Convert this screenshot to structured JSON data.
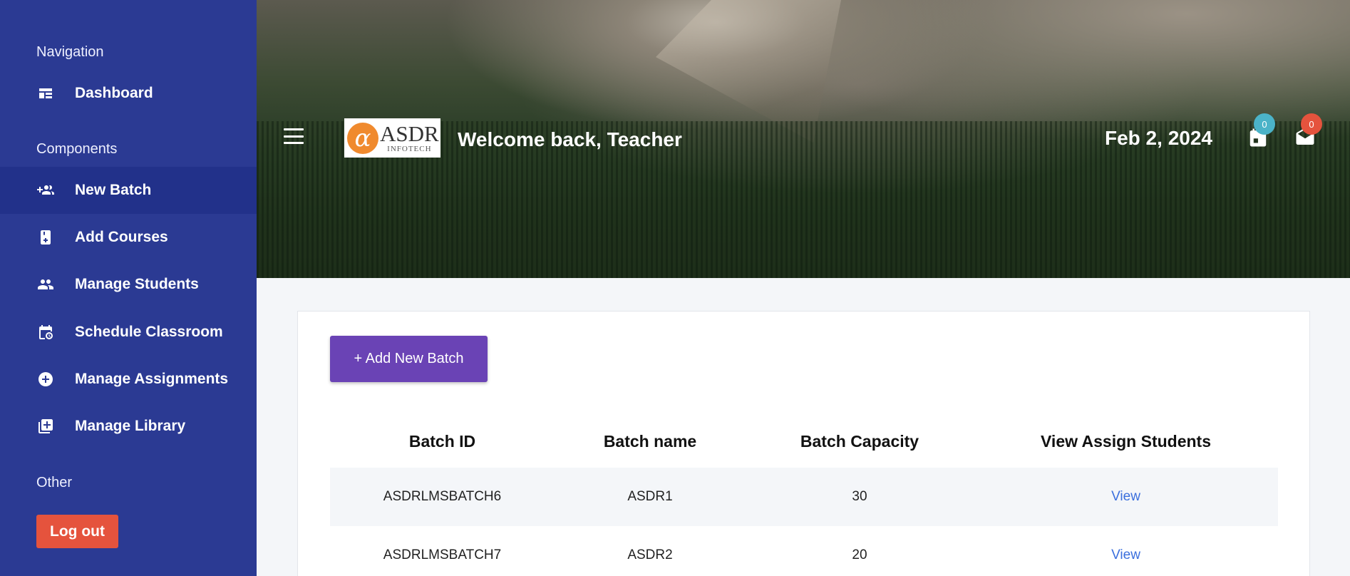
{
  "sidebar": {
    "sections": {
      "navigation": "Navigation",
      "components": "Components",
      "other": "Other"
    },
    "items": [
      {
        "label": "Dashboard",
        "icon": "dashboard-icon"
      },
      {
        "label": "New Batch",
        "icon": "group-add-icon",
        "active": true
      },
      {
        "label": "Add Courses",
        "icon": "book-add-icon"
      },
      {
        "label": "Manage Students",
        "icon": "people-icon"
      },
      {
        "label": "Schedule Classroom",
        "icon": "calendar-clock-icon"
      },
      {
        "label": "Manage Assignments",
        "icon": "plus-circle-icon"
      },
      {
        "label": "Manage Library",
        "icon": "library-add-icon"
      }
    ],
    "logout_label": "Log out"
  },
  "header": {
    "welcome": "Welcome back, Teacher",
    "logo_main": "ASDR",
    "logo_sub": "INFOTECH",
    "logo_symbol": "α",
    "date": "Feb 2, 2024",
    "calendar_badge": "0",
    "mail_badge": "0",
    "colors": {
      "calendar_badge": "#4bb3c8",
      "mail_badge": "#e5533d"
    }
  },
  "main": {
    "add_button_label": "+ Add New Batch",
    "table": {
      "headers": [
        "Batch ID",
        "Batch name",
        "Batch Capacity",
        "View Assign Students"
      ],
      "rows": [
        {
          "id": "ASDRLMSBATCH6",
          "name": "ASDR1",
          "capacity": "30",
          "link": "View"
        },
        {
          "id": "ASDRLMSBATCH7",
          "name": "ASDR2",
          "capacity": "20",
          "link": "View"
        }
      ]
    }
  },
  "colors": {
    "sidebar_bg": "#2b3a93",
    "sidebar_active": "#22318a",
    "logout_bg": "#e5533d",
    "add_button_bg": "#6a43b5",
    "link": "#3b6fdd"
  }
}
